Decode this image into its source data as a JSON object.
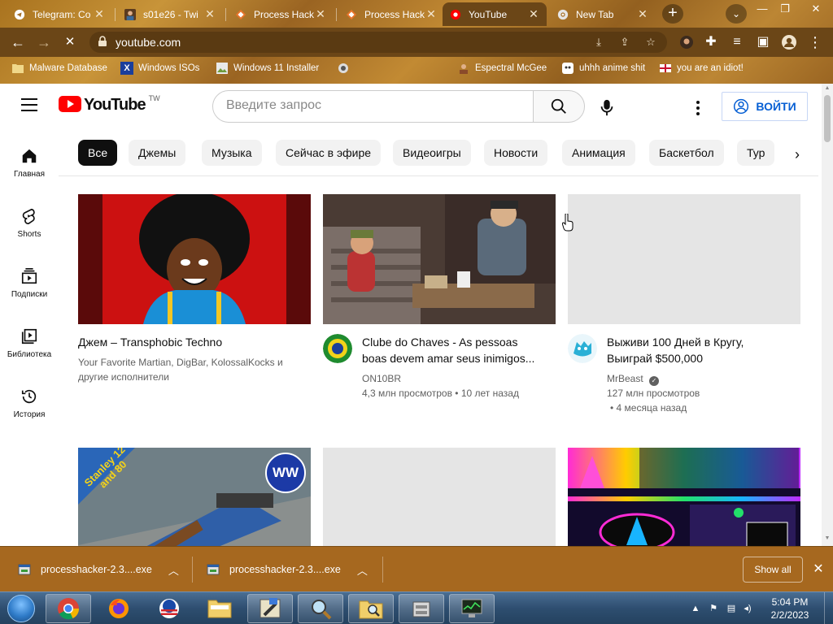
{
  "browser": {
    "tabs": [
      {
        "title": "Telegram: Co",
        "icon": "telegram-icon"
      },
      {
        "title": "s01e26 - Twi",
        "icon": "person-favicon"
      },
      {
        "title": "Process Hack",
        "icon": "diamond-favicon"
      },
      {
        "title": "Process Hack",
        "icon": "diamond-favicon"
      },
      {
        "title": "YouTube",
        "icon": "youtube-icon"
      },
      {
        "title": "New Tab",
        "icon": "chrome-icon"
      }
    ],
    "url": "youtube.com",
    "bookmarks": [
      {
        "label": "Malware Database",
        "icon": "folder-icon"
      },
      {
        "label": "Windows ISOs",
        "icon": "x-logo-icon"
      },
      {
        "label": "Windows 11 Installer",
        "icon": "image-icon"
      },
      {
        "label": "",
        "icon": "game-icon"
      },
      {
        "label": "Espectral McGee",
        "icon": "person-favicon"
      },
      {
        "label": "uhhh anime shit",
        "icon": "anime-favicon"
      },
      {
        "label": "you are an idiot!",
        "icon": "flag-favicon"
      }
    ]
  },
  "youtube": {
    "logo_text": "YouTube",
    "region": "TW",
    "search_placeholder": "Введите запрос",
    "signin_label": "ВОЙТИ",
    "guide": [
      {
        "label": "Главная",
        "icon": "home-icon"
      },
      {
        "label": "Shorts",
        "icon": "shorts-icon"
      },
      {
        "label": "Подписки",
        "icon": "subscriptions-icon"
      },
      {
        "label": "Библиотека",
        "icon": "library-icon"
      },
      {
        "label": "История",
        "icon": "history-icon"
      }
    ],
    "chips": [
      "Все",
      "Джемы",
      "Музыка",
      "Сейчас в эфире",
      "Видеоигры",
      "Новости",
      "Анимация",
      "Баскетбол",
      "Тур"
    ],
    "videos": [
      {
        "title": "Джем – Transphobic Techno",
        "title_line2": "",
        "channel": "Your Favorite Martian, DigBar, KolossalKocks и",
        "meta_line": "другие исполнители",
        "meta_line2": "",
        "verified": false
      },
      {
        "title": "Clube do Chaves - As pessoas",
        "title_line2": "boas devem amar seus inimigos...",
        "channel": "ON10BR",
        "meta_line": "4,3 млн просмотров • 10 лет назад",
        "meta_line2": "",
        "verified": false
      },
      {
        "title": "Выживи 100 Дней в Кругу,",
        "title_line2": "Выиграй $500,000",
        "channel": "MrBeast",
        "meta_line": "127 млн просмотров",
        "meta_line2": "• 4 месяца назад",
        "verified": true
      }
    ],
    "row2_thumb_text": {
      "stanley": "Stanley 12 and 80",
      "badge": "WW"
    }
  },
  "downloads": {
    "items": [
      {
        "filename": "processhacker-2.3....exe"
      },
      {
        "filename": "processhacker-2.3....exe"
      }
    ],
    "show_all": "Show all"
  },
  "taskbar": {
    "time": "5:04 PM",
    "date": "2/2/2023"
  },
  "colors": {
    "chrome_toolbar": "#6b4617",
    "youtube_red": "#ff0000",
    "signin_blue": "#065fd4",
    "downloads_bar": "#a6681f"
  }
}
